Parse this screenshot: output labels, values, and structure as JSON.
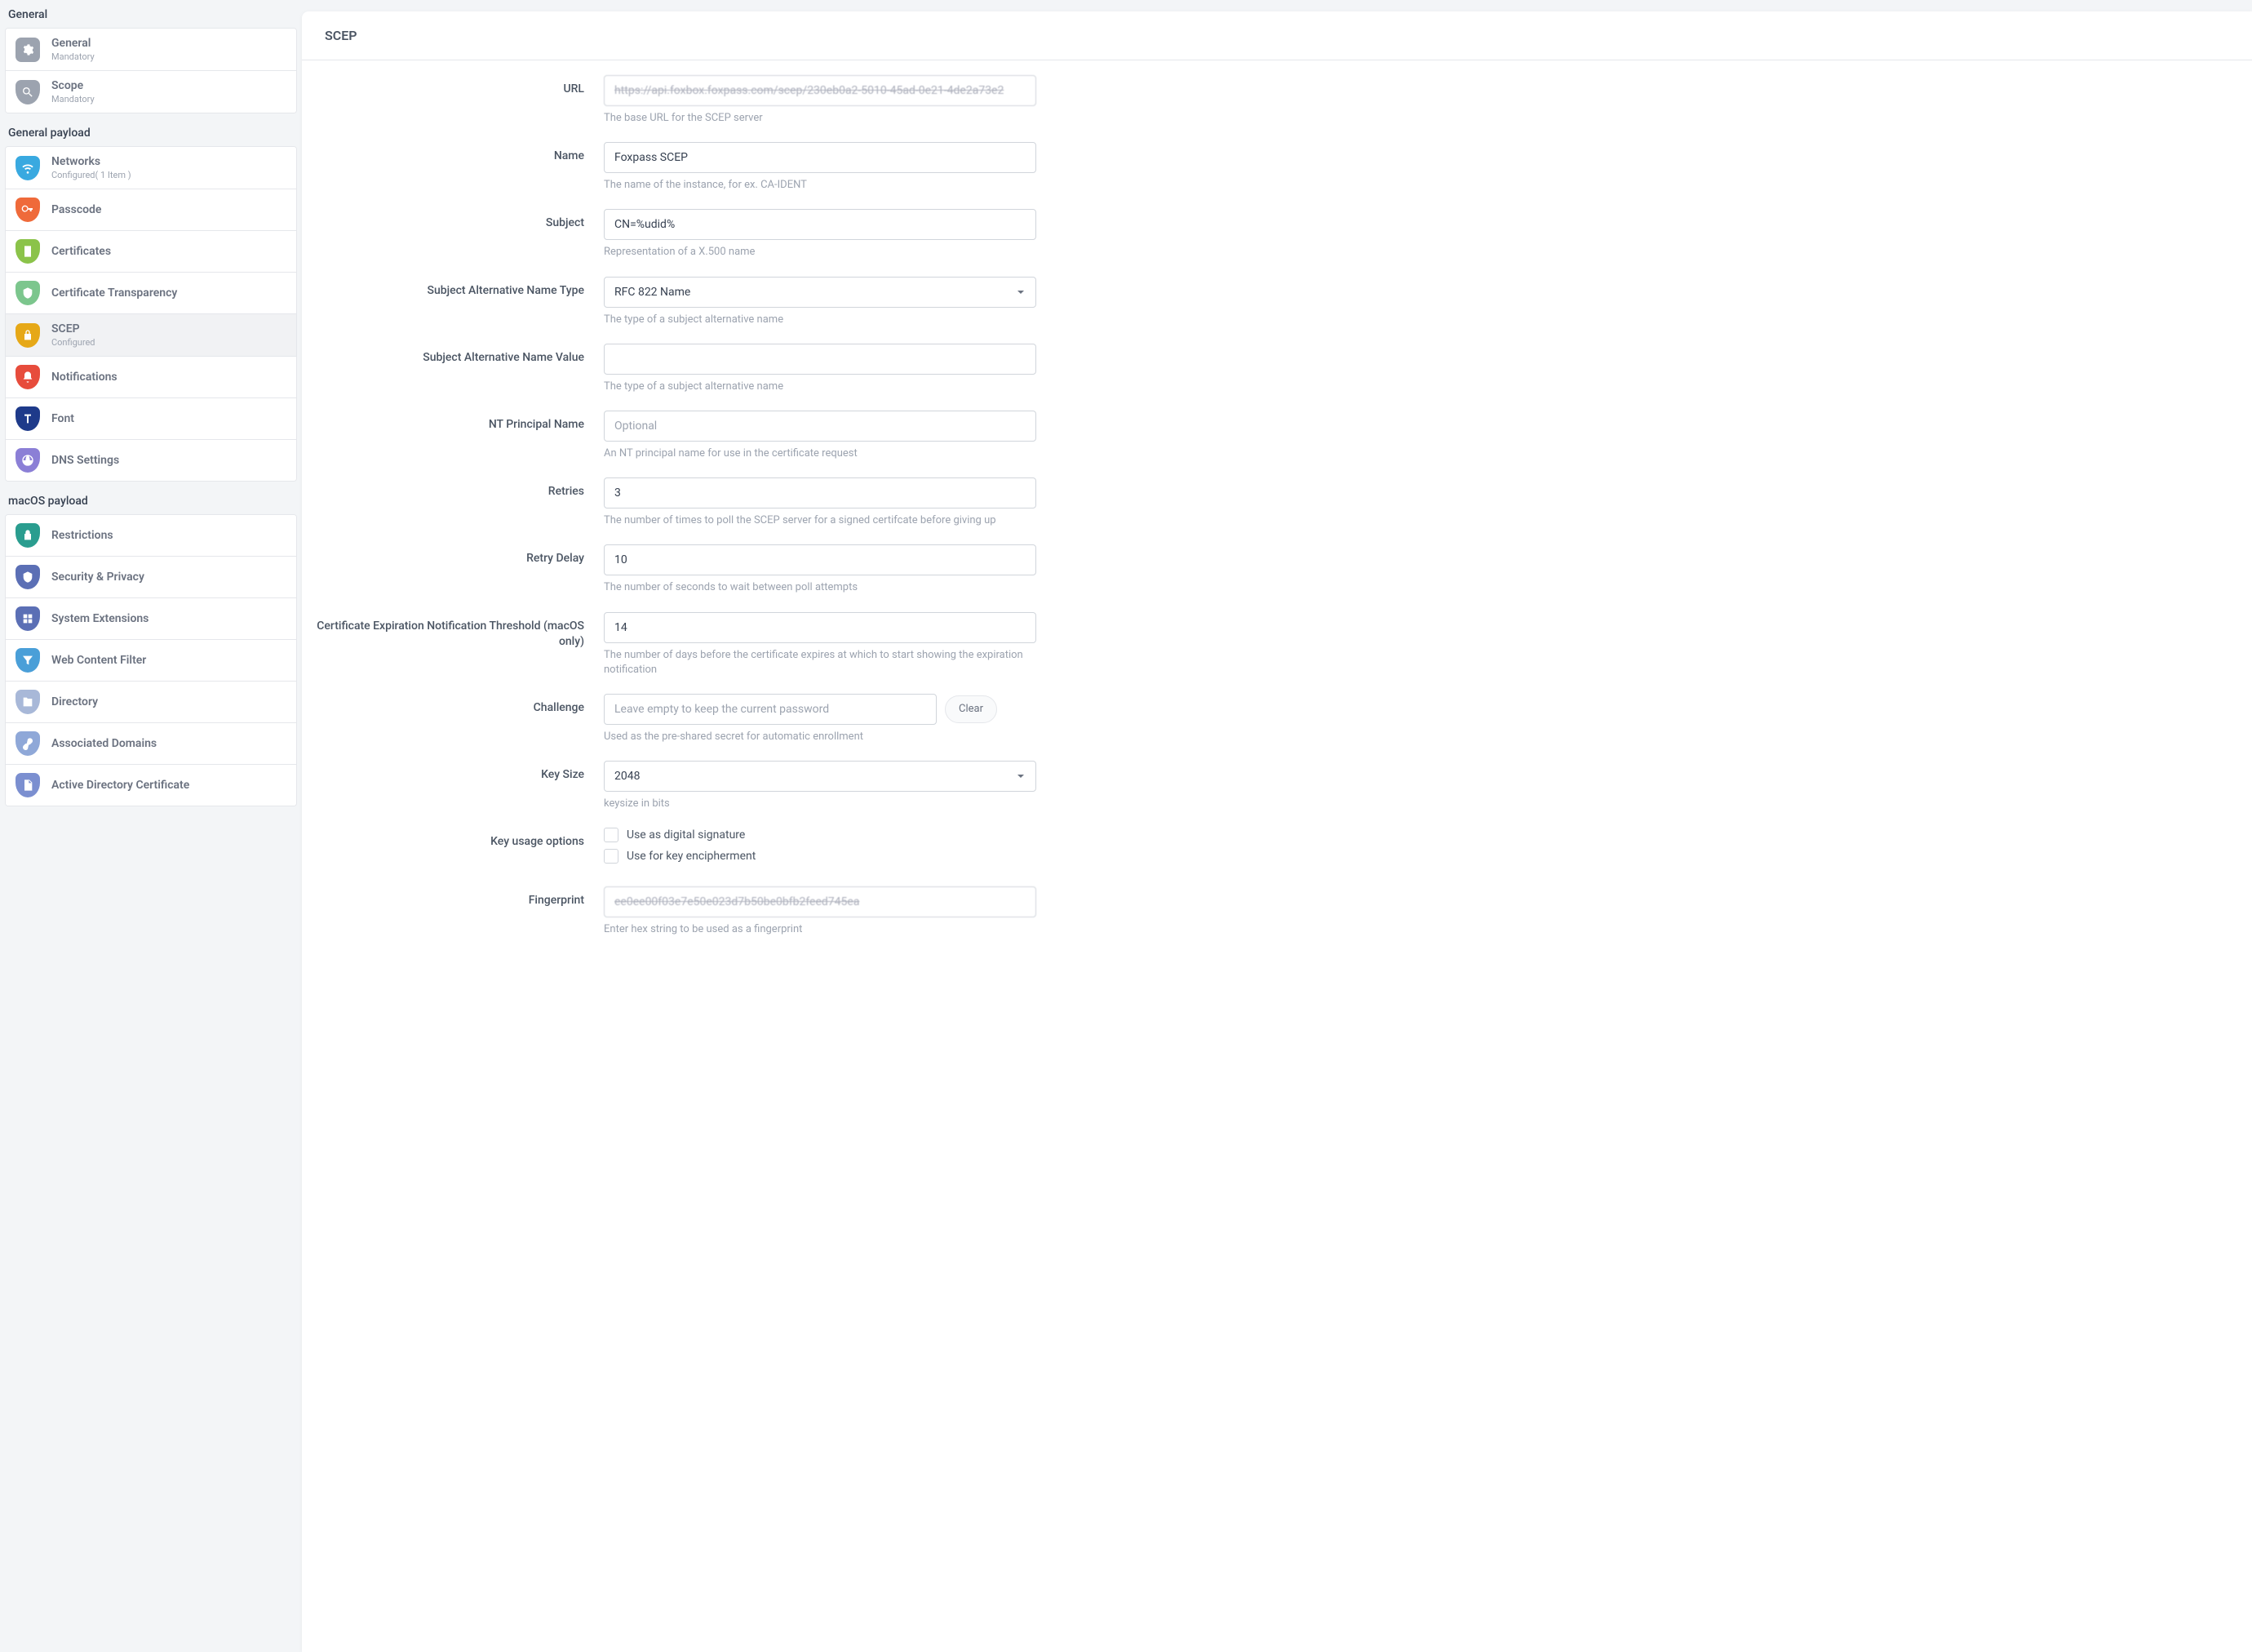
{
  "sidebar": {
    "sections": [
      {
        "title": "General",
        "items": [
          {
            "id": "general",
            "label": "General",
            "sublabel": "Mandatory",
            "color": "#9ca3af",
            "icon": "gear"
          },
          {
            "id": "scope",
            "label": "Scope",
            "sublabel": "Mandatory",
            "color": "#9ca3af",
            "icon": "lens"
          }
        ]
      },
      {
        "title": "General payload",
        "items": [
          {
            "id": "networks",
            "label": "Networks",
            "sublabel": "Configured( 1 Item )",
            "color": "#39a9e0",
            "icon": "wifi"
          },
          {
            "id": "passcode",
            "label": "Passcode",
            "sublabel": "",
            "color": "#ef6a3a",
            "icon": "key"
          },
          {
            "id": "certificates",
            "label": "Certificates",
            "sublabel": "",
            "color": "#8bc34a",
            "icon": "cert"
          },
          {
            "id": "certtrans",
            "label": "Certificate Transparency",
            "sublabel": "",
            "color": "#7cc68d",
            "icon": "shield"
          },
          {
            "id": "scep",
            "label": "SCEP",
            "sublabel": "Configured",
            "color": "#e6a817",
            "icon": "lock",
            "active": true
          },
          {
            "id": "notifications",
            "label": "Notifications",
            "sublabel": "",
            "color": "#e74c3c",
            "icon": "bell"
          },
          {
            "id": "font",
            "label": "Font",
            "sublabel": "",
            "color": "#1e3a8a",
            "icon": "font"
          },
          {
            "id": "dns",
            "label": "DNS Settings",
            "sublabel": "",
            "color": "#8b7fd6",
            "icon": "globe"
          }
        ]
      },
      {
        "title": "macOS payload",
        "items": [
          {
            "id": "restrictions",
            "label": "Restrictions",
            "sublabel": "",
            "color": "#2a9d8f",
            "icon": "lock"
          },
          {
            "id": "security",
            "label": "Security & Privacy",
            "sublabel": "",
            "color": "#5b6fb5",
            "icon": "shield"
          },
          {
            "id": "sysext",
            "label": "System Extensions",
            "sublabel": "",
            "color": "#5b6fb5",
            "icon": "grid"
          },
          {
            "id": "webfilter",
            "label": "Web Content Filter",
            "sublabel": "",
            "color": "#4a9fd8",
            "icon": "funnel"
          },
          {
            "id": "directory",
            "label": "Directory",
            "sublabel": "",
            "color": "#a8b8d8",
            "icon": "dir"
          },
          {
            "id": "assocdom",
            "label": "Associated Domains",
            "sublabel": "",
            "color": "#8fa8d8",
            "icon": "link"
          },
          {
            "id": "adcert",
            "label": "Active Directory Certificate",
            "sublabel": "",
            "color": "#7b8fd0",
            "icon": "doc"
          }
        ]
      }
    ]
  },
  "main": {
    "title": "SCEP",
    "fields": {
      "url": {
        "label": "URL",
        "value": "https://api.foxbox.foxpass.com/scep/230eb0a2-5010-45ad-0e21-4de2a73e2",
        "help": "The base URL for the SCEP server"
      },
      "name": {
        "label": "Name",
        "value": "Foxpass SCEP",
        "help": "The name of the instance, for ex. CA-IDENT"
      },
      "subject": {
        "label": "Subject",
        "value": "CN=%udid%",
        "help": "Representation of a X.500 name"
      },
      "sanType": {
        "label": "Subject Alternative Name Type",
        "value": "RFC 822 Name",
        "help": "The type of a subject alternative name"
      },
      "sanValue": {
        "label": "Subject Alternative Name Value",
        "value": "",
        "help": "The type of a subject alternative name"
      },
      "ntPrincipal": {
        "label": "NT Principal Name",
        "placeholder": "Optional",
        "value": "",
        "help": "An NT principal name for use in the certificate request"
      },
      "retries": {
        "label": "Retries",
        "value": "3",
        "help": "The number of times to poll the SCEP server for a signed certifcate before giving up"
      },
      "retryDelay": {
        "label": "Retry Delay",
        "value": "10",
        "help": "The number of seconds to wait between poll attempts"
      },
      "certExpNotif": {
        "label": "Certificate Expiration Notification Threshold (macOS only)",
        "value": "14",
        "help": "The number of days before the certificate expires at which to start showing the expiration notification"
      },
      "challenge": {
        "label": "Challenge",
        "placeholder": "Leave empty to keep the current password",
        "value": "",
        "help": "Used as the pre-shared secret for automatic enrollment",
        "clearLabel": "Clear"
      },
      "keySize": {
        "label": "Key Size",
        "value": "2048",
        "help": "keysize in bits"
      },
      "keyUsage": {
        "label": "Key usage options",
        "opt1": "Use as digital signature",
        "opt2": "Use for key encipherment"
      },
      "fingerprint": {
        "label": "Fingerprint",
        "value": "ee0ee00f03e7e50e023d7b50be0bfb2feed745ea",
        "help": "Enter hex string to be used as a fingerprint"
      }
    }
  }
}
